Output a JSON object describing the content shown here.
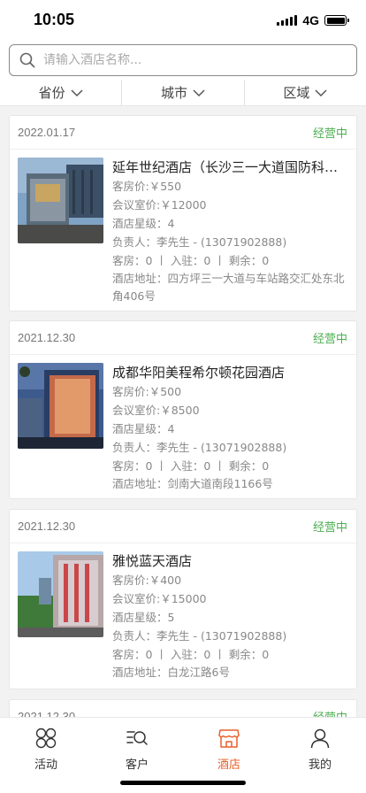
{
  "status": {
    "time": "10:05",
    "network": "4G"
  },
  "search": {
    "placeholder": "请输入酒店名称..."
  },
  "filters": [
    "省份",
    "城市",
    "区域"
  ],
  "hotels": [
    {
      "date": "2022.01.17",
      "status": "经营中",
      "name": "延年世纪酒店（长沙三一大道国防科技大学店）",
      "room_price": "客房价:￥550",
      "meeting_price": "会议室价:￥12000",
      "star": "酒店星级：4",
      "manager": "负责人：李先生 - (13071902888)",
      "counts": "客房：0 丨 入驻：0 丨 剩余：0",
      "address": "酒店地址：四方坪三一大道与车站路交汇处东北角406号"
    },
    {
      "date": "2021.12.30",
      "status": "经营中",
      "name": "成都华阳美程希尔顿花园酒店",
      "room_price": "客房价:￥500",
      "meeting_price": "会议室价:￥8500",
      "star": "酒店星级：4",
      "manager": "负责人：李先生 - (13071902888)",
      "counts": "客房：0 丨 入驻：0 丨 剩余：0",
      "address": "酒店地址：剑南大道南段1166号"
    },
    {
      "date": "2021.12.30",
      "status": "经营中",
      "name": "雅悦蓝天酒店",
      "room_price": "客房价:￥400",
      "meeting_price": "会议室价:￥15000",
      "star": "酒店星级：5",
      "manager": "负责人：李先生 - (13071902888)",
      "counts": "客房：0 丨 入驻：0 丨 剩余：0",
      "address": "酒店地址：白龙江路6号"
    },
    {
      "date": "2021.12.30",
      "status": "经营中"
    }
  ],
  "tabs": [
    {
      "label": "活动",
      "icon": "activity-icon",
      "active": false
    },
    {
      "label": "客户",
      "icon": "customer-list-icon",
      "active": false
    },
    {
      "label": "酒店",
      "icon": "hotel-store-icon",
      "active": true
    },
    {
      "label": "我的",
      "icon": "person-icon",
      "active": false
    }
  ],
  "colors": {
    "accent": "#e8612c",
    "status_green": "#4caf50"
  }
}
